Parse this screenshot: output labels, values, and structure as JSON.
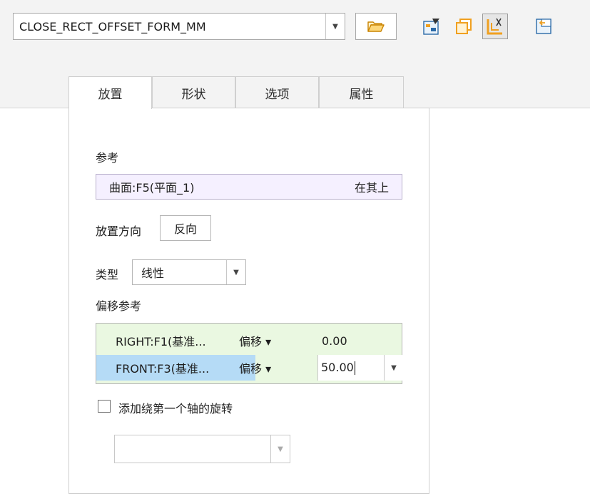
{
  "toolbar": {
    "form_name": "CLOSE_RECT_OFFSET_FORM_MM",
    "icons": [
      "dropdown-arrow-icon",
      "open-folder-icon",
      "edit-definition-icon",
      "copy-sketch-icon",
      "offset-placement-icon",
      "pin-panel-icon"
    ]
  },
  "tabs": [
    "放置",
    "形状",
    "选项",
    "属性"
  ],
  "placement": {
    "reference_label": "参考",
    "reference_item": "曲面:F5(平面_1)",
    "reference_type": "在其上",
    "direction_label": "放置方向",
    "flip_button": "反向",
    "type_label": "类型",
    "type_value": "线性",
    "offset_refs_label": "偏移参考",
    "offset_rows": [
      {
        "name": "RIGHT:F1(基准...",
        "kind": "偏移 ▾",
        "value": "0.00"
      },
      {
        "name": "FRONT:F3(基准...",
        "kind": "偏移 ▾",
        "value": "50.00"
      }
    ],
    "rotation_checkbox_label": "添加绕第一个轴的旋转",
    "rotation_value": ""
  },
  "colors": {
    "reference_bg": "#f5f0ff",
    "offset_table_bg": "#eaf8e1",
    "selected_row_bg": "#b5dbf6",
    "icon_orange": "#f0a020"
  }
}
